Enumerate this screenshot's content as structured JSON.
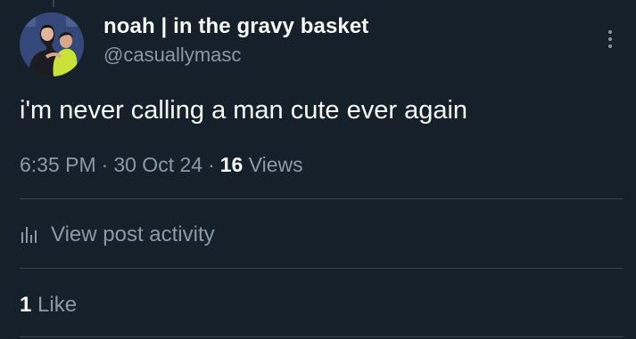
{
  "author": {
    "display_name": "noah | in the gravy basket",
    "handle": "@casuallymasc"
  },
  "post": {
    "text": "i'm never calling a man cute ever again",
    "time": "6:35 PM",
    "date": "30 Oct 24",
    "separator": "·",
    "views_count": "16",
    "views_label": "Views"
  },
  "activity": {
    "label": "View post activity",
    "icon": "bar-chart-icon"
  },
  "engagement": {
    "likes_count": "1",
    "likes_label": "Like"
  },
  "menu": {
    "icon": "more-vertical-icon"
  },
  "colors": {
    "background": "#15202b",
    "primary_text": "#f7f9f9",
    "secondary_text": "#8b98a5",
    "divider": "#38444d"
  }
}
